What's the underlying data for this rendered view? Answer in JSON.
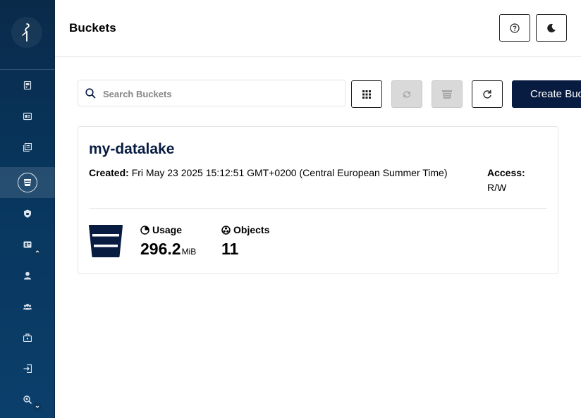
{
  "header": {
    "title": "Buckets"
  },
  "sidebar": {
    "items": [
      {
        "icon": "dashboard-icon"
      },
      {
        "icon": "monitoring-icon"
      },
      {
        "icon": "logs-icon"
      },
      {
        "icon": "buckets-icon",
        "active": true
      },
      {
        "icon": "policies-icon"
      },
      {
        "icon": "identity-icon"
      },
      {
        "icon": "user-icon"
      },
      {
        "icon": "groups-icon"
      },
      {
        "icon": "service-accounts-icon"
      },
      {
        "icon": "login-icon"
      },
      {
        "icon": "lookup-icon"
      }
    ]
  },
  "toolbar": {
    "search_placeholder": "Search Buckets",
    "search_value": "",
    "create_label": "Create Bucket"
  },
  "bucket": {
    "name": "my-datalake",
    "created_label": "Created:",
    "created_value": "Fri May 23 2025 15:12:51 GMT+0200 (Central European Summer Time)",
    "access_label": "Access:",
    "access_value": "R/W",
    "usage_label": "Usage",
    "usage_value": "296.2",
    "usage_unit": "MiB",
    "objects_label": "Objects",
    "objects_value": "11"
  },
  "colors": {
    "sidebar": "#0a2a4a",
    "accent": "#081c42",
    "disabled": "#d9d9d9"
  }
}
